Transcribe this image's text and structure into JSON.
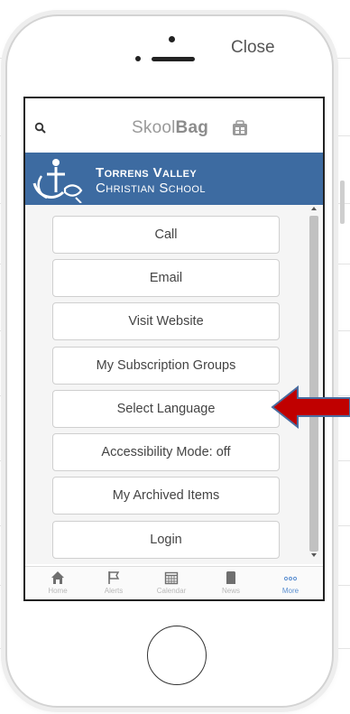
{
  "window": {
    "close_label": "Close"
  },
  "header": {
    "logo_light": "Skool",
    "logo_bold": "Bag"
  },
  "school": {
    "name_line1": "Torrens Valley",
    "name_line2": "Christian School"
  },
  "menu": {
    "items": [
      {
        "label": "Call"
      },
      {
        "label": "Email"
      },
      {
        "label": "Visit Website"
      },
      {
        "label": "My Subscription Groups"
      },
      {
        "label": "Select Language"
      },
      {
        "label": "Accessibility Mode: off"
      },
      {
        "label": "My Archived Items"
      },
      {
        "label": "Login"
      }
    ]
  },
  "tabs": [
    {
      "label": "Home",
      "icon": "home-icon"
    },
    {
      "label": "Alerts",
      "icon": "flag-icon"
    },
    {
      "label": "Calendar",
      "icon": "calendar-icon"
    },
    {
      "label": "News",
      "icon": "news-icon"
    },
    {
      "label": "More",
      "icon": "more-icon",
      "active": true
    }
  ],
  "colors": {
    "banner": "#3d6ba1",
    "arrow": "#c00000",
    "active_tab": "#5b8fd0"
  }
}
